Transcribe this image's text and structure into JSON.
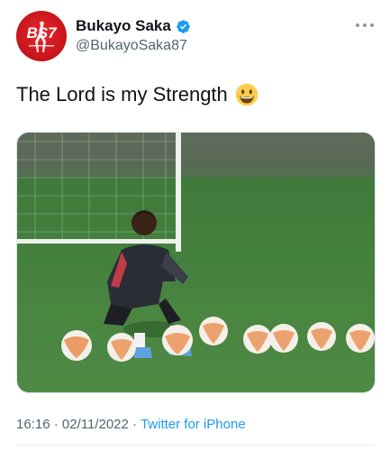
{
  "author": {
    "display_name": "Bukayo Saka",
    "handle": "@BukayoSaka87",
    "verified": true,
    "avatar_icon": "bs87-logo-avatar"
  },
  "tweet": {
    "text": "The Lord is my Strength",
    "emoji": "grinning-face-emoji"
  },
  "media": {
    "type": "photo"
  },
  "meta": {
    "time": "16:16",
    "date": "02/11/2022",
    "separator": "·",
    "source": "Twitter for iPhone"
  },
  "colors": {
    "link": "#1d9bf0",
    "verified": "#1d9bf0",
    "secondary_text": "#536471",
    "avatar_red": "#d41c22"
  }
}
